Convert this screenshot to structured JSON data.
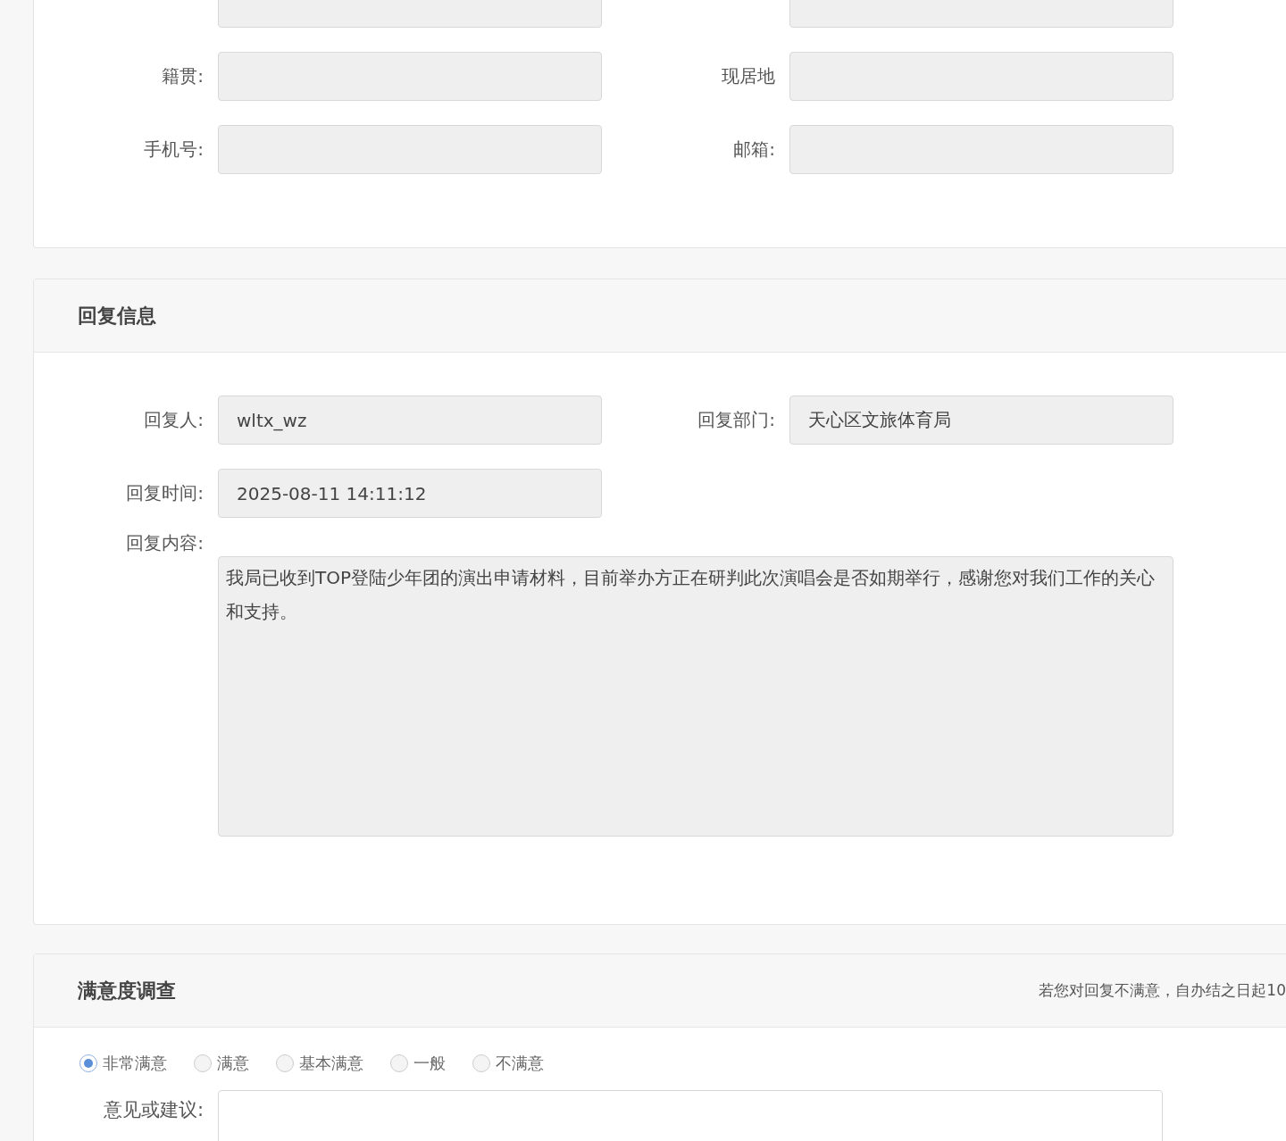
{
  "personal_info": {
    "rows": [
      [
        {
          "label": "籍贯:"
        },
        {
          "label": "现居地"
        }
      ],
      [
        {
          "label": "手机号:"
        },
        {
          "label": "邮箱:"
        }
      ]
    ]
  },
  "reply_info": {
    "title": "回复信息",
    "rows": [
      [
        {
          "label": "回复人:",
          "value": "wltx_wz"
        },
        {
          "label": "回复部门:",
          "value": "天心区文旅体育局"
        }
      ],
      [
        {
          "label": "回复时间:",
          "value": "2025-08-11 14:11:12"
        }
      ]
    ],
    "content": {
      "label": "回复内容:",
      "value": "我局已收到TOP登陆少年团的演出申请材料，目前举办方正在研判此次演唱会是否如期举行，感谢您对我们工作的关心和支持。"
    }
  },
  "satisfaction": {
    "title": "满意度调查",
    "hint": "若您对回复不满意，自办结之日起10",
    "options": [
      {
        "label": "非常满意",
        "selected": true
      },
      {
        "label": "满意",
        "selected": false
      },
      {
        "label": "基本满意",
        "selected": false
      },
      {
        "label": "一般",
        "selected": false
      },
      {
        "label": "不满意",
        "selected": false
      }
    ],
    "suggestion": {
      "label": "意见或建议:"
    }
  }
}
